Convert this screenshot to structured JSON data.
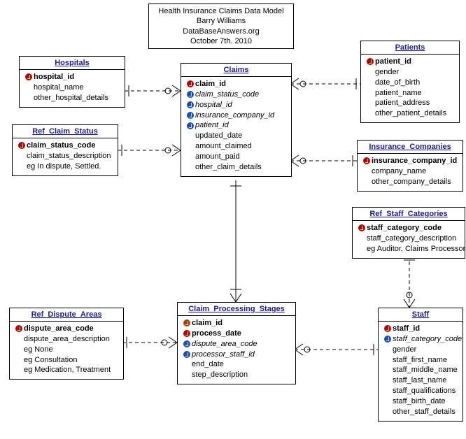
{
  "title": {
    "line1": "Health Insurance Claims Data Model",
    "line2": "Barry Williams",
    "line3": "DataBaseAnswers.org",
    "line4": "October 7th. 2010"
  },
  "entities": {
    "hospitals": {
      "name": "Hospitals",
      "cols": [
        {
          "key": "pk",
          "label": "hospital_id",
          "bold": true
        },
        {
          "key": "",
          "label": "hospital_name"
        },
        {
          "key": "",
          "label": "other_hospital_details"
        }
      ]
    },
    "ref_claim_status": {
      "name": "Ref_Claim_Status",
      "cols": [
        {
          "key": "pk",
          "label": "claim_status_code",
          "bold": true
        },
        {
          "key": "",
          "label": "claim_status_description"
        },
        {
          "key": "",
          "label": "eg In dispute, Settled."
        }
      ]
    },
    "claims": {
      "name": "Claims",
      "cols": [
        {
          "key": "pk",
          "label": "claim_id",
          "bold": true
        },
        {
          "key": "fk",
          "label": "claim_status_code",
          "italic": true
        },
        {
          "key": "fk",
          "label": "hospital_id",
          "italic": true
        },
        {
          "key": "fk",
          "label": "insurance_company_id",
          "italic": true
        },
        {
          "key": "fk",
          "label": "patient_id",
          "italic": true
        },
        {
          "key": "",
          "label": "updated_date"
        },
        {
          "key": "",
          "label": "amount_claimed"
        },
        {
          "key": "",
          "label": "amount_paid"
        },
        {
          "key": "",
          "label": "other_claim_details"
        }
      ]
    },
    "patients": {
      "name": "Patients",
      "cols": [
        {
          "key": "pk",
          "label": "patient_id",
          "bold": true
        },
        {
          "key": "",
          "label": "gender"
        },
        {
          "key": "",
          "label": "date_of_birth"
        },
        {
          "key": "",
          "label": "patient_name"
        },
        {
          "key": "",
          "label": "patient_address"
        },
        {
          "key": "",
          "label": "other_patient_details"
        }
      ]
    },
    "insurance_companies": {
      "name": "Insurance_Companies",
      "cols": [
        {
          "key": "pk",
          "label": "insurance_company_id",
          "bold": true
        },
        {
          "key": "",
          "label": "company_name"
        },
        {
          "key": "",
          "label": "other_company_details"
        }
      ]
    },
    "ref_staff_categories": {
      "name": "Ref_Staff_Categories",
      "cols": [
        {
          "key": "pk",
          "label": "staff_category_code",
          "bold": true
        },
        {
          "key": "",
          "label": "staff_category_description"
        },
        {
          "key": "",
          "label": "eg Auditor, Claims Processor"
        }
      ]
    },
    "ref_dispute_areas": {
      "name": "Ref_Dispute_Areas",
      "cols": [
        {
          "key": "pk",
          "label": "dispute_area_code",
          "bold": true
        },
        {
          "key": "",
          "label": "dispute_area_description"
        },
        {
          "key": "",
          "label": "eg None"
        },
        {
          "key": "",
          "label": "eg Consultation"
        },
        {
          "key": "",
          "label": "eg Medication, Treatment"
        }
      ]
    },
    "claim_processing_stages": {
      "name": "Claim_Processing_Stages",
      "cols": [
        {
          "key": "pf",
          "label": "claim_id",
          "bold": true
        },
        {
          "key": "pk",
          "label": "process_date",
          "bold": true
        },
        {
          "key": "fk",
          "label": "dispute_area_code",
          "italic": true
        },
        {
          "key": "fk",
          "label": "processor_staff_id",
          "italic": true
        },
        {
          "key": "",
          "label": "end_date"
        },
        {
          "key": "",
          "label": "step_description"
        }
      ]
    },
    "staff": {
      "name": "Staff",
      "cols": [
        {
          "key": "pk",
          "label": "staff_id",
          "bold": true
        },
        {
          "key": "fk",
          "label": "staff_category_code",
          "italic": true
        },
        {
          "key": "",
          "label": "gender"
        },
        {
          "key": "",
          "label": "staff_first_name"
        },
        {
          "key": "",
          "label": "staff_middle_name"
        },
        {
          "key": "",
          "label": "staff_last_name"
        },
        {
          "key": "",
          "label": "staff_qualifications"
        },
        {
          "key": "",
          "label": "staff_birth_date"
        },
        {
          "key": "",
          "label": "other_staff_details"
        }
      ]
    }
  }
}
